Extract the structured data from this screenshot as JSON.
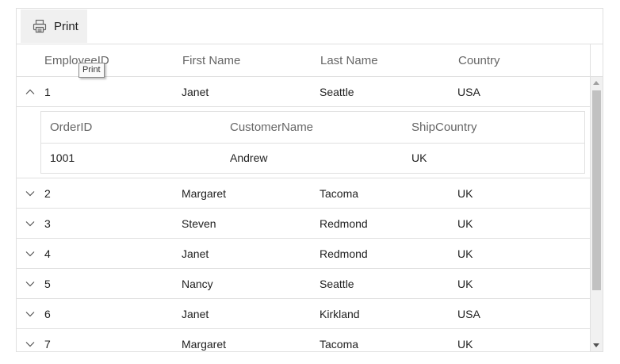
{
  "toolbar": {
    "print_label": "Print",
    "print_icon": "printer-icon",
    "tooltip": "Print"
  },
  "columns": [
    "EmployeeID",
    "First Name",
    "Last Name",
    "Country"
  ],
  "rows": [
    {
      "EmployeeID": "1",
      "FirstName": "Janet",
      "LastName": "Seattle",
      "Country": "USA",
      "expanded": true
    },
    {
      "EmployeeID": "2",
      "FirstName": "Margaret",
      "LastName": "Tacoma",
      "Country": "UK",
      "expanded": false
    },
    {
      "EmployeeID": "3",
      "FirstName": "Steven",
      "LastName": "Redmond",
      "Country": "UK",
      "expanded": false
    },
    {
      "EmployeeID": "4",
      "FirstName": "Janet",
      "LastName": "Redmond",
      "Country": "UK",
      "expanded": false
    },
    {
      "EmployeeID": "5",
      "FirstName": "Nancy",
      "LastName": "Seattle",
      "Country": "UK",
      "expanded": false
    },
    {
      "EmployeeID": "6",
      "FirstName": "Janet",
      "LastName": "Kirkland",
      "Country": "USA",
      "expanded": false
    },
    {
      "EmployeeID": "7",
      "FirstName": "Margaret",
      "LastName": "Tacoma",
      "Country": "UK",
      "expanded": false
    }
  ],
  "detail": {
    "columns": [
      "OrderID",
      "CustomerName",
      "ShipCountry"
    ],
    "rows": [
      {
        "OrderID": "1001",
        "CustomerName": "Andrew",
        "ShipCountry": "UK"
      }
    ]
  },
  "colors": {
    "border": "#e0e0e0",
    "header_text": "#666666",
    "cell_text": "#212121",
    "button_bg": "#f0f0f0",
    "scrollbar_thumb": "#c1c1c1"
  },
  "icons": {
    "expand": "chevron-down-icon",
    "collapse": "chevron-up-icon"
  }
}
